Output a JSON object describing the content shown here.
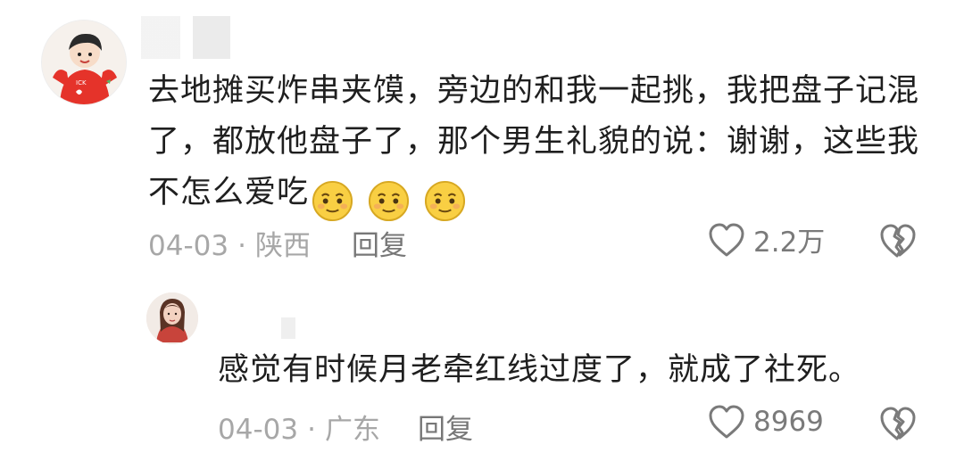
{
  "comment": {
    "line1": "去地摊买炸串夹馍，旁边的和我一起挑，我把盘子记混",
    "line2": "了，都放他盘子了，那个男生礼貌的说：谢谢，这些我",
    "line3": "不怎么爱吃",
    "emoji": "smiling-face-emoji",
    "date": "04-03",
    "location": "陕西",
    "reply_label": "回复",
    "likes": "2.2万"
  },
  "reply": {
    "text": "感觉有时候月老牵红线过度了，就成了社死。",
    "date": "04-03",
    "location": "广东",
    "reply_label": "回复",
    "likes": "8969"
  },
  "separator": "·",
  "icons": {
    "like": "heart-outline-icon",
    "dislike": "broken-heart-icon"
  },
  "colors": {
    "text": "#1f1f1f",
    "meta": "#a7a7a7",
    "icon": "#7a7a7a"
  }
}
